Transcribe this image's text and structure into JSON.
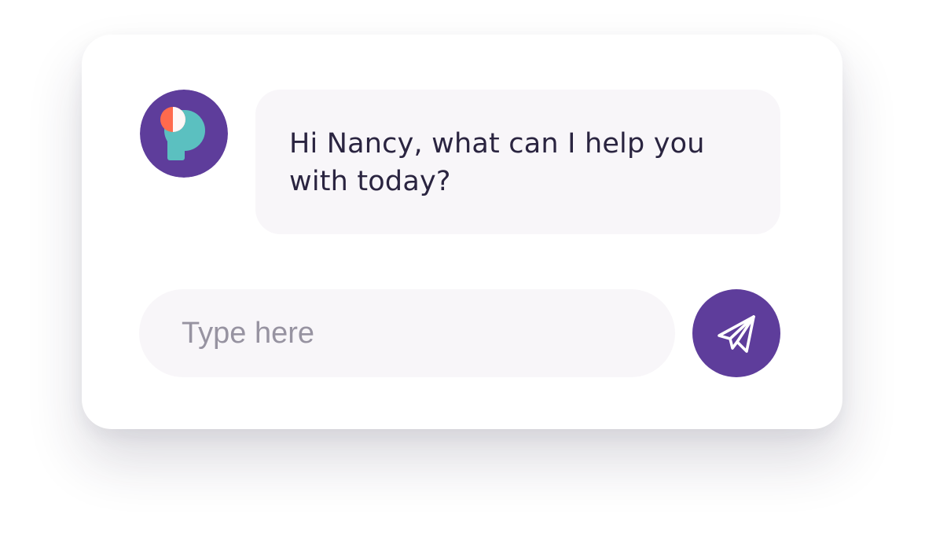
{
  "theme": {
    "brand_purple": "#5e3d9b",
    "bubble_background": "#f8f6f9",
    "text_color": "#2a2440",
    "placeholder_color": "#9793a1",
    "logo_orange": "#ff6a4d",
    "logo_teal": "#5bc0c0"
  },
  "chat": {
    "bot_avatar_icon": "p-logo-icon",
    "greeting": "Hi Nancy, what can I help you with today?"
  },
  "composer": {
    "value": "",
    "placeholder": "Type here",
    "send_icon": "paper-plane-icon"
  }
}
